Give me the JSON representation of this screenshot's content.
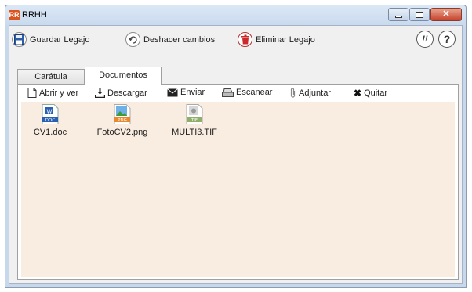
{
  "window": {
    "title": "RRHH",
    "app_icon_text": "RR"
  },
  "toolbar": {
    "guardar_label": "Guardar Legajo",
    "deshacer_label": "Deshacer cambios",
    "eliminar_label": "Eliminar Legajo",
    "info_label": "!!",
    "help_label": "?"
  },
  "tabs": [
    {
      "label": "Carátula",
      "active": false
    },
    {
      "label": "Documentos",
      "active": true
    }
  ],
  "doc_toolbar": {
    "abrir_label": "Abrir y ver",
    "descargar_label": "Descargar",
    "enviar_label": "Enviar",
    "escanear_label": "Escanear",
    "adjuntar_label": "Adjuntar",
    "quitar_label": "Quitar"
  },
  "files": [
    {
      "name": "CV1.doc",
      "badge": "DOC",
      "icon": "word-doc-icon"
    },
    {
      "name": "FotoCV2.png",
      "badge": "PNG",
      "icon": "png-image-icon"
    },
    {
      "name": "MULTI3.TIF",
      "badge": "TIF",
      "icon": "tif-image-icon"
    }
  ],
  "colors": {
    "file_area_bg": "#f9ece0",
    "title_bar": "#c9daee",
    "delete_red": "#cc2a2a",
    "save_blue": "#2e5da8"
  }
}
